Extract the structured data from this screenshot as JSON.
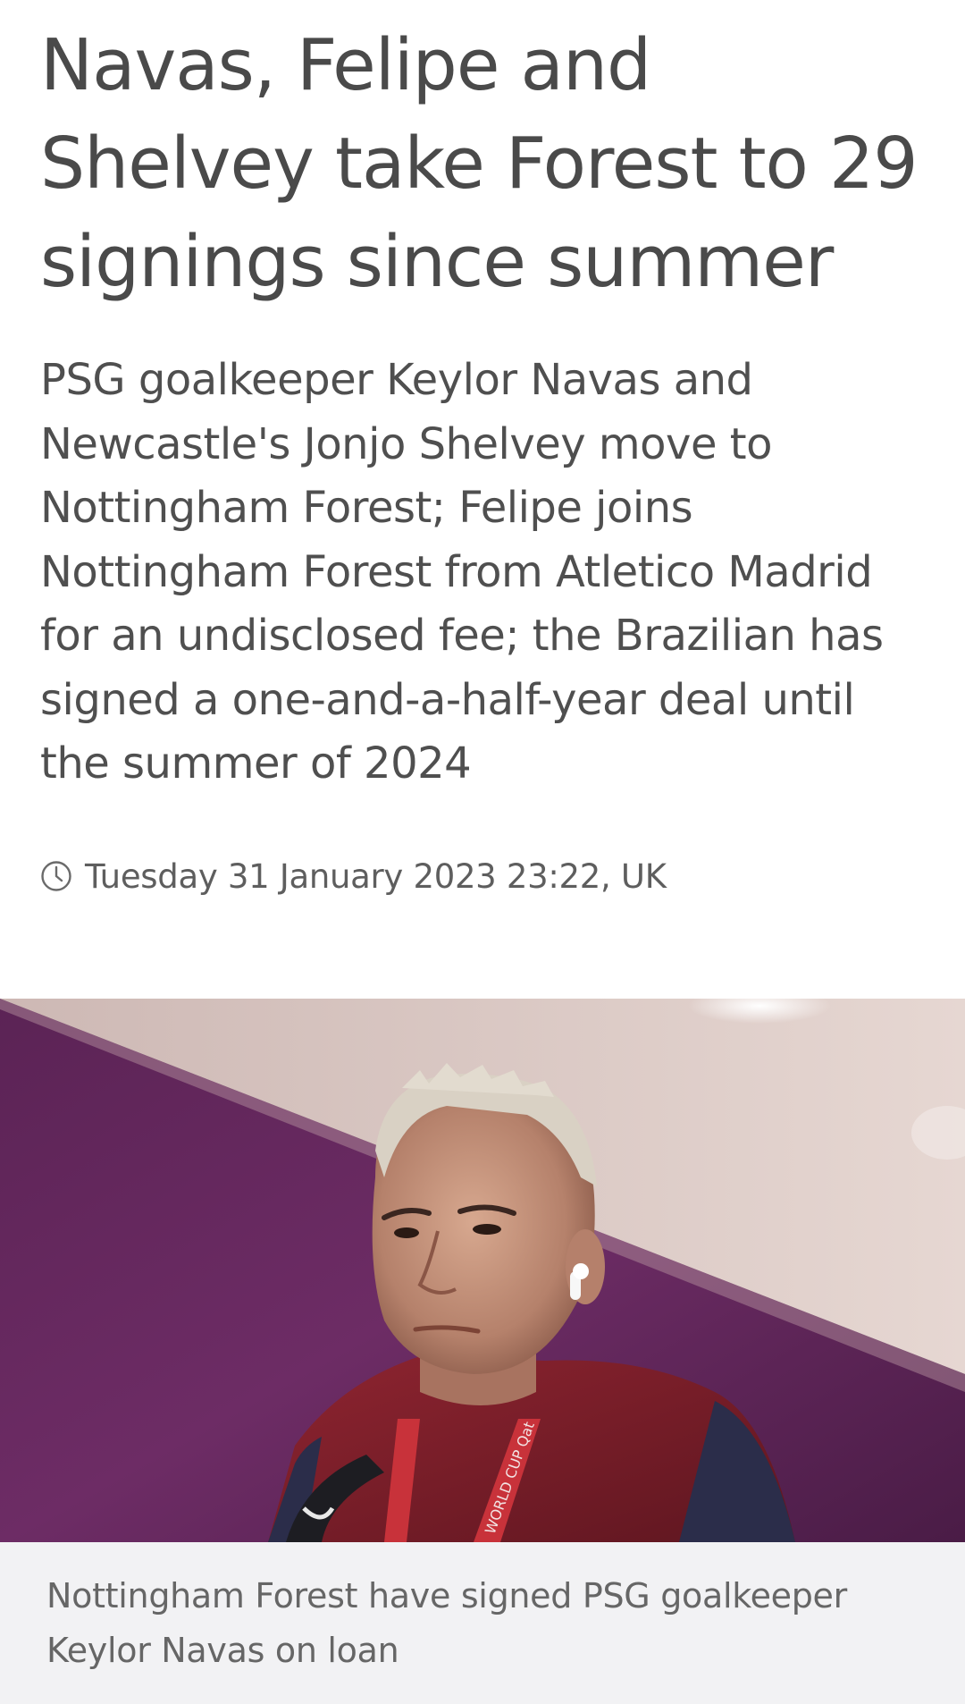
{
  "article": {
    "headline": "Navas, Felipe and Shelvey take Forest to 29 signings since summer",
    "standfirst": "PSG goalkeeper Keylor Navas and Newcastle's Jonjo Shelvey move to Nottingham Forest; Felipe joins Nottingham Forest from Atletico Madrid for an undisclosed fee; the Brazilian has signed a one-and-a-half-year deal until the summer of 2024",
    "timestamp": "Tuesday 31 January 2023 23:22, UK",
    "timestamp_icon": "clock-icon",
    "image": {
      "lanyard_text": "WORLD CUP Qat",
      "caption": "Nottingham Forest have signed PSG goalkeeper Keylor Navas on loan"
    }
  },
  "colors": {
    "text": "#4a4a4a",
    "caption_background": "#f2f2f4",
    "photo_wall": "#6b2a63"
  }
}
